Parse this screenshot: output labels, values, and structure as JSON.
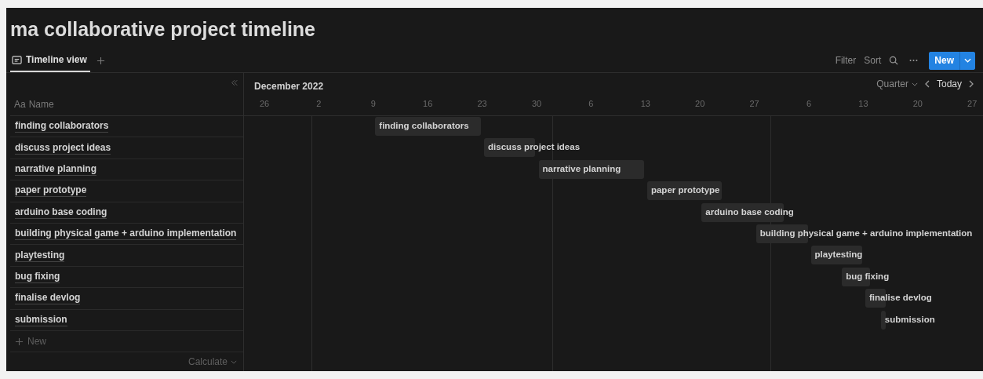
{
  "title": "ma collaborative project timeline",
  "views": [
    {
      "label": "Timeline view",
      "selected": true
    }
  ],
  "toolbar": {
    "filter": "Filter",
    "sort": "Sort",
    "new_button": "New"
  },
  "timeline": {
    "month": "December 2022",
    "scale": "Quarter",
    "today": "Today",
    "dates": [
      "26",
      "2",
      "9",
      "16",
      "23",
      "30",
      "6",
      "13",
      "20",
      "27",
      "6",
      "13",
      "20",
      "27"
    ]
  },
  "table": {
    "column_icon": "Aa",
    "column": "Name",
    "new_row": "New",
    "footer": "Calculate",
    "rows": [
      {
        "name": "finding collaborators"
      },
      {
        "name": "discuss project ideas"
      },
      {
        "name": "narrative planning"
      },
      {
        "name": "paper prototype"
      },
      {
        "name": "arduino base coding"
      },
      {
        "name": "building physical game + arduino implementation"
      },
      {
        "name": "playtesting"
      },
      {
        "name": "bug fixing"
      },
      {
        "name": "finalise devlog"
      },
      {
        "name": "submission"
      }
    ]
  },
  "bars": [
    {
      "label": "finding collaborators"
    },
    {
      "label": "discuss project ideas"
    },
    {
      "label": "narrative planning"
    },
    {
      "label": "paper prototype"
    },
    {
      "label": "arduino base coding"
    },
    {
      "label": "building physical game + arduino implementation"
    },
    {
      "label": "playtesting"
    },
    {
      "label": "bug fixing"
    },
    {
      "label": "finalise devlog"
    },
    {
      "label": "submission"
    }
  ]
}
